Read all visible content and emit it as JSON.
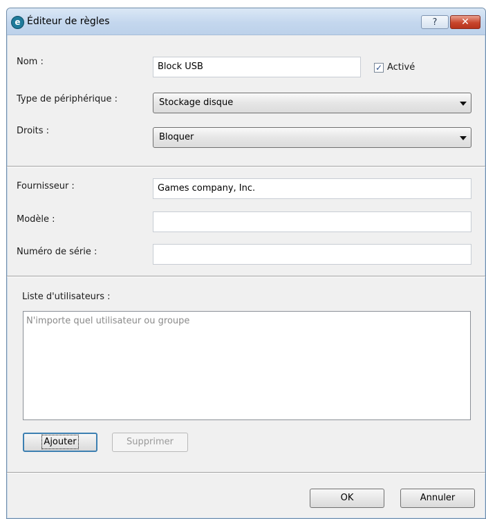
{
  "window": {
    "title": "Éditeur de règles",
    "app_icon": "e",
    "help_glyph": "?",
    "close_glyph": "✕"
  },
  "fields": {
    "name": {
      "label": "Nom :",
      "value": "Block USB"
    },
    "enabled": {
      "label": "Activé",
      "checked": true,
      "mark": "✓"
    },
    "device_type": {
      "label": "Type de périphérique :",
      "value": "Stockage disque"
    },
    "rights": {
      "label": "Droits :",
      "value": "Bloquer"
    },
    "vendor": {
      "label": "Fournisseur :",
      "value": "Games company, Inc."
    },
    "model": {
      "label": "Modèle :",
      "value": ""
    },
    "serial": {
      "label": "Numéro de série :",
      "value": ""
    }
  },
  "users": {
    "label": "Liste d'utilisateurs :",
    "placeholder": "N'importe quel utilisateur ou groupe",
    "add_label": "Ajouter",
    "remove_label": "Supprimer"
  },
  "footer": {
    "ok_label": "OK",
    "cancel_label": "Annuler"
  },
  "colors": {
    "titlebar": "#c4d7ee",
    "close": "#c8452c",
    "focus": "#3c7fb1"
  }
}
